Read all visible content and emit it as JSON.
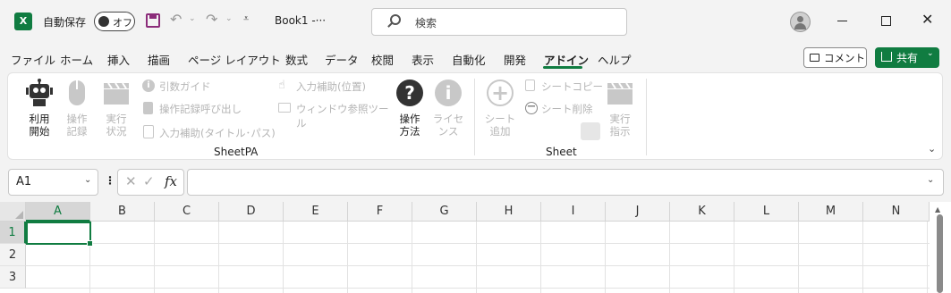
{
  "titlebar": {
    "autosave_label": "自動保存",
    "autosave_state": "オフ",
    "filename": "Book1  -···",
    "search_placeholder": "検索",
    "qat_more": "⩡"
  },
  "tabs": [
    "ファイル",
    "ホーム",
    "挿入",
    "描画",
    "ページ レイアウト",
    "数式",
    "データ",
    "校閲",
    "表示",
    "自動化",
    "開発",
    "アドイン",
    "ヘルプ"
  ],
  "active_tab": "アドイン",
  "actions": {
    "comment_label": "コメント",
    "share_label": "共有"
  },
  "ribbon": {
    "sheetpa": {
      "group_label": "SheetPA",
      "use_start": [
        "利用",
        "開始"
      ],
      "op_record": [
        "操作",
        "記録"
      ],
      "exec_status": [
        "実行",
        "状況"
      ],
      "arg_guide": "引数ガイド",
      "op_record_call": "操作記録呼び出し",
      "input_assist_title": "入力補助(タイトル･パス)",
      "input_assist_pos": "入力補助(位置)",
      "window_ref_tool": "ウィンドウ参照ツール",
      "how_to": [
        "操作",
        "方法"
      ],
      "license": [
        "ライセ",
        "ンス"
      ]
    },
    "sheet": {
      "group_label": "Sheet",
      "add_sheet": [
        "シート",
        "追加"
      ],
      "copy_sheet": "シートコピー",
      "delete_sheet": "シート削除",
      "exec_instruct": [
        "実行",
        "指示"
      ]
    }
  },
  "formula_bar": {
    "name_box": "A1",
    "fx": "fx",
    "formula": ""
  },
  "grid": {
    "columns": [
      "A",
      "B",
      "C",
      "D",
      "E",
      "F",
      "G",
      "H",
      "I",
      "J",
      "K",
      "L",
      "M",
      "N"
    ],
    "rows": [
      "1",
      "2",
      "3"
    ],
    "selected_cell": "A1"
  },
  "colors": {
    "accent": "#107c41",
    "save_icon": "#8b2c7a"
  }
}
